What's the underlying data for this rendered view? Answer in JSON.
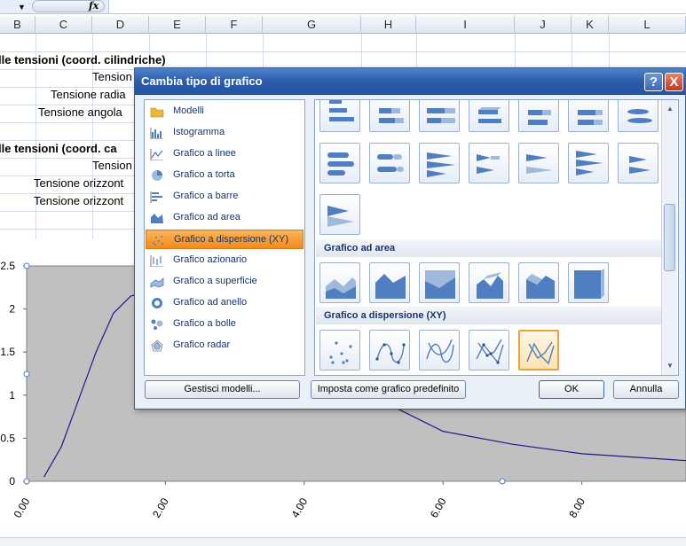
{
  "formula_bar": {
    "fx_label": "fx"
  },
  "columns": [
    "B",
    "C",
    "D",
    "E",
    "F",
    "G",
    "H",
    "I",
    "J",
    "K",
    "L"
  ],
  "cells": {
    "r1": "lle tensioni (coord. cilindriche)",
    "r2": "Tension",
    "r3": "Tensione radia",
    "r4": "Tensione angola",
    "r5": "lle tensioni (coord. ca",
    "r6": "Tension",
    "r7": "Tensione orizzont",
    "r8": "Tensione orizzont"
  },
  "chart_data": {
    "type": "line",
    "title": "",
    "xlabel": "",
    "ylabel": "",
    "x_ticks": [
      "0.00",
      "2.00",
      "4.00",
      "6.00",
      "8.00"
    ],
    "y_ticks": [
      "0",
      "0.5",
      "1",
      "1.5",
      "2",
      "2.5"
    ],
    "xlim": [
      0,
      9.5
    ],
    "ylim": [
      0,
      2.5
    ],
    "series": [
      {
        "x": [
          0.25,
          0.5,
          0.75,
          1.0,
          1.25,
          1.5,
          1.75,
          2.0,
          6.0,
          7.0,
          8.0,
          9.5
        ],
        "values": [
          0.05,
          0.4,
          0.95,
          1.5,
          1.95,
          2.15,
          2.2,
          2.18,
          0.58,
          0.43,
          0.32,
          0.24
        ]
      }
    ],
    "grid": false,
    "plot_background": "#c0c0c0",
    "line_color": "#1a1a8c"
  },
  "dialog": {
    "title": "Cambia tipo di grafico",
    "help_label": "?",
    "close_label": "X",
    "chart_types": [
      {
        "label": "Modelli",
        "icon": "folder-icon"
      },
      {
        "label": "Istogramma",
        "icon": "column-chart-icon"
      },
      {
        "label": "Grafico a linee",
        "icon": "line-chart-icon"
      },
      {
        "label": "Grafico a torta",
        "icon": "pie-chart-icon"
      },
      {
        "label": "Grafico a barre",
        "icon": "bar-chart-icon"
      },
      {
        "label": "Grafico ad area",
        "icon": "area-chart-icon"
      },
      {
        "label": "Grafico a dispersione (XY)",
        "icon": "scatter-chart-icon",
        "selected": true
      },
      {
        "label": "Grafico azionario",
        "icon": "stock-chart-icon"
      },
      {
        "label": "Grafico a superficie",
        "icon": "surface-chart-icon"
      },
      {
        "label": "Grafico ad anello",
        "icon": "doughnut-chart-icon"
      },
      {
        "label": "Grafico a bolle",
        "icon": "bubble-chart-icon"
      },
      {
        "label": "Grafico radar",
        "icon": "radar-chart-icon"
      }
    ],
    "sections": {
      "area": "Grafico ad area",
      "scatter": "Grafico a dispersione (XY)"
    },
    "buttons": {
      "manage": "Gestisci modelli...",
      "set_default": "Imposta come grafico predefinito",
      "ok": "OK",
      "cancel": "Annulla"
    },
    "colors": {
      "accent": "#f28a1c",
      "titlebar": "#2a5aa8"
    }
  }
}
